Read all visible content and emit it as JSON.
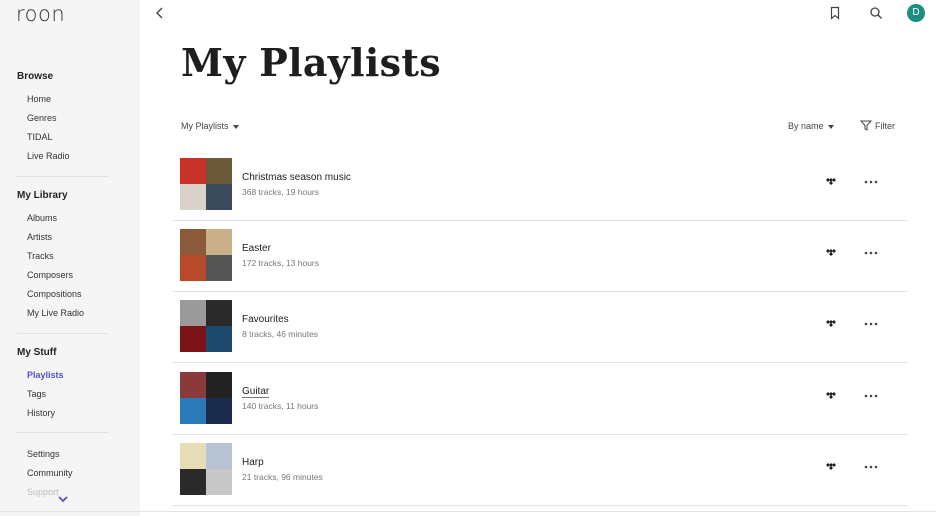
{
  "app": {
    "logo": "roon",
    "user_initial": "D",
    "accent": "#5250c8",
    "avatar_color": "#1a8f7f"
  },
  "sidebar": {
    "browse": {
      "title": "Browse",
      "items": [
        "Home",
        "Genres",
        "TIDAL",
        "Live Radio"
      ]
    },
    "library": {
      "title": "My Library",
      "items": [
        "Albums",
        "Artists",
        "Tracks",
        "Composers",
        "Compositions",
        "My Live Radio"
      ]
    },
    "stuff": {
      "title": "My Stuff",
      "items": [
        "Playlists",
        "Tags",
        "History"
      ],
      "active": "Playlists"
    },
    "misc": {
      "items": [
        "Settings",
        "Community",
        "Support"
      ]
    }
  },
  "header": {
    "back_icon": "chevron-left-icon",
    "bookmark_icon": "bookmark-icon",
    "search_icon": "search-icon"
  },
  "main": {
    "title": "My Playlists",
    "filter_dropdown": "My Playlists",
    "sort_label": "By name",
    "filter_label": "Filter",
    "playlists": [
      {
        "name": "Christmas season music",
        "meta": "368 tracks, 19 hours",
        "colors": [
          "#c83228",
          "#6b5a3a",
          "#d9d2c8",
          "#3a4a5c"
        ]
      },
      {
        "name": "Easter",
        "meta": "172 tracks, 13 hours",
        "colors": [
          "#8a5a3a",
          "#c9b089",
          "#b84a2a",
          "#555555"
        ]
      },
      {
        "name": "Favourites",
        "meta": "8 tracks, 46 minutes",
        "colors": [
          "#9a9a9a",
          "#2a2a2a",
          "#7a1418",
          "#1e4a6e"
        ]
      },
      {
        "name": "Guitar",
        "meta": "140 tracks, 11 hours",
        "colors": [
          "#8a3a3a",
          "#222222",
          "#2a7ab8",
          "#1a2a4a"
        ]
      },
      {
        "name": "Harp",
        "meta": "21 tracks, 96 minutes",
        "colors": [
          "#e6ddb8",
          "#b8c4d4",
          "#2a2a2a",
          "#c8c8c8"
        ]
      }
    ]
  }
}
